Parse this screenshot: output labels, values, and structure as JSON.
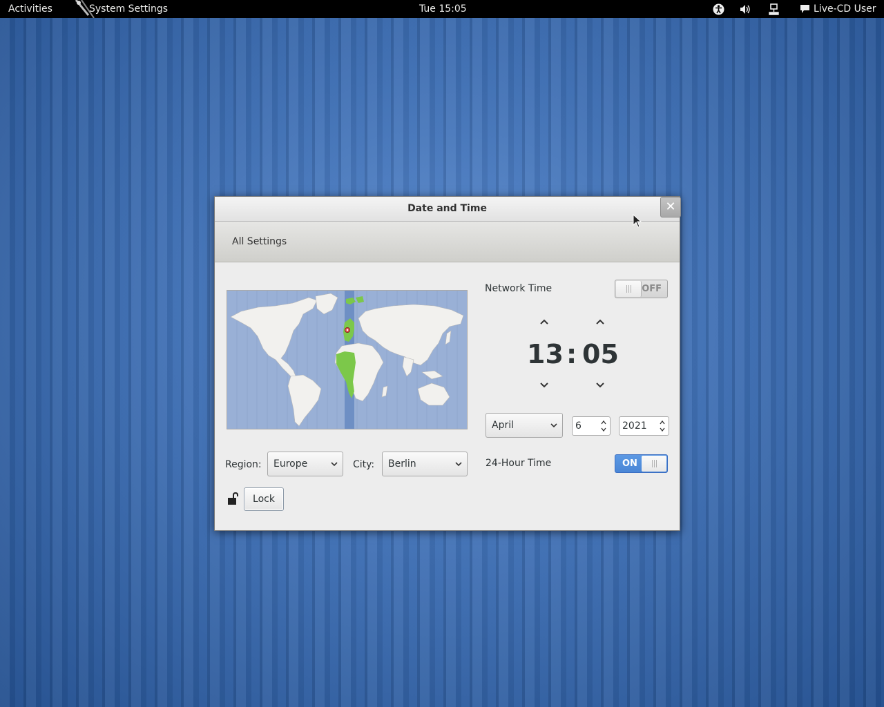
{
  "topbar": {
    "activities": "Activities",
    "app_menu": "System Settings",
    "clock": "Tue 15:05",
    "user": "Live-CD User",
    "icons": [
      "accessibility-icon",
      "volume-icon",
      "network-icon",
      "chat-icon"
    ]
  },
  "window": {
    "title": "Date and Time",
    "close_glyph": "✕",
    "toolbar": {
      "all_settings": "All Settings"
    },
    "timezone": {
      "region_label": "Region:",
      "region_value": "Europe",
      "city_label": "City:",
      "city_value": "Berlin"
    },
    "lock_button": "Lock",
    "network_time": {
      "label": "Network Time",
      "state": "OFF"
    },
    "time": {
      "hours": "13",
      "separator": ":",
      "minutes": "05"
    },
    "date": {
      "month": "April",
      "day": "6",
      "year": "2021"
    },
    "hour24": {
      "label": "24-Hour Time",
      "state": "ON"
    }
  },
  "colors": {
    "desktop_blue": "#3f6fb3",
    "switch_on_blue": "#4a86d6",
    "map_ocean": "#99b0d6",
    "map_land": "#f2f1ee",
    "timezone_highlight": "#7cc84a"
  }
}
